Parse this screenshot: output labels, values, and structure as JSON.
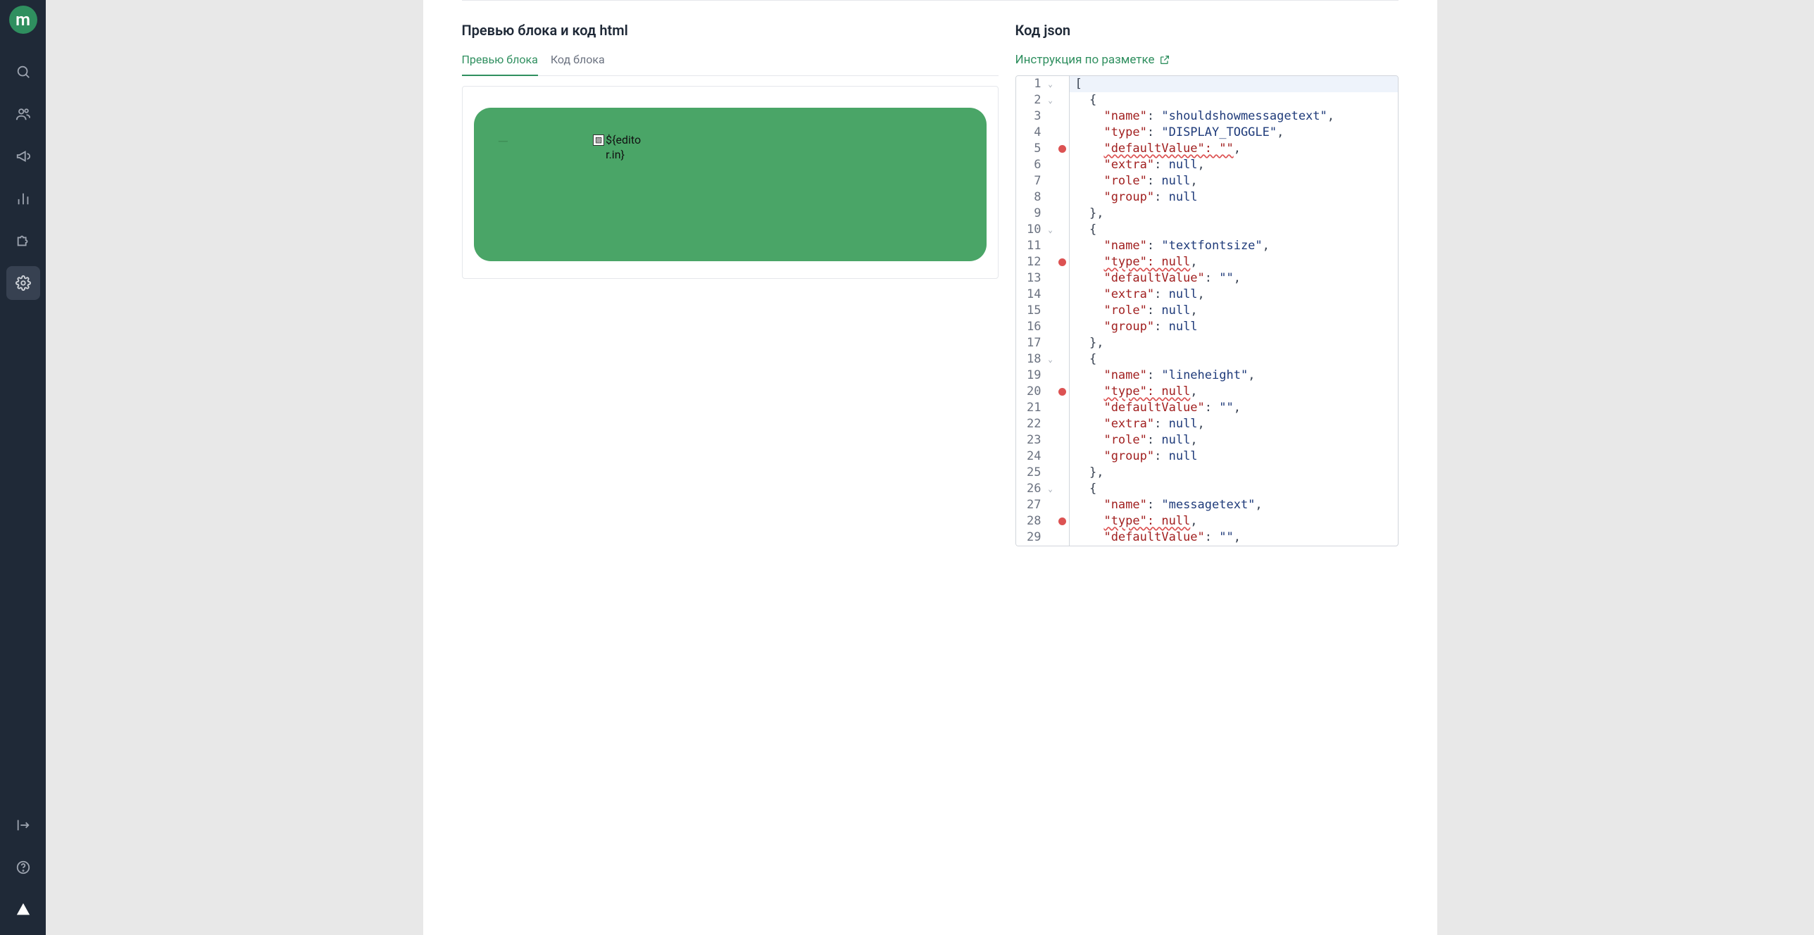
{
  "logo_letter": "m",
  "left_title": "Превью блока и код html",
  "right_title": "Код json",
  "instruction_link": "Инструкция по разметке",
  "tabs": {
    "preview": "Превью блока",
    "code": "Код блока"
  },
  "preview": {
    "placeholder_text": "${editor.in}",
    "placeholder_icon_label": "▨"
  },
  "json_editor": {
    "lines": [
      {
        "n": 1,
        "fold": true,
        "err": false,
        "tokens": [
          [
            "punc",
            "["
          ]
        ],
        "highlight": true
      },
      {
        "n": 2,
        "fold": true,
        "err": false,
        "tokens": [
          [
            "indent",
            1
          ],
          [
            "punc",
            "{"
          ]
        ]
      },
      {
        "n": 3,
        "fold": false,
        "err": false,
        "tokens": [
          [
            "indent",
            2
          ],
          [
            "key",
            "\"name\""
          ],
          [
            "punc",
            ": "
          ],
          [
            "str",
            "\"shouldshowmessagetext\""
          ],
          [
            "punc",
            ","
          ]
        ]
      },
      {
        "n": 4,
        "fold": false,
        "err": false,
        "tokens": [
          [
            "indent",
            2
          ],
          [
            "key",
            "\"type\""
          ],
          [
            "punc",
            ": "
          ],
          [
            "str",
            "\"DISPLAY_TOGGLE\""
          ],
          [
            "punc",
            ","
          ]
        ]
      },
      {
        "n": 5,
        "fold": false,
        "err": true,
        "tokens": [
          [
            "indent",
            2
          ],
          [
            "keyerr",
            "\"defaultValue\": \"\""
          ],
          [
            "punc",
            ","
          ]
        ]
      },
      {
        "n": 6,
        "fold": false,
        "err": false,
        "tokens": [
          [
            "indent",
            2
          ],
          [
            "key",
            "\"extra\""
          ],
          [
            "punc",
            ": "
          ],
          [
            "null",
            "null"
          ],
          [
            "punc",
            ","
          ]
        ]
      },
      {
        "n": 7,
        "fold": false,
        "err": false,
        "tokens": [
          [
            "indent",
            2
          ],
          [
            "key",
            "\"role\""
          ],
          [
            "punc",
            ": "
          ],
          [
            "null",
            "null"
          ],
          [
            "punc",
            ","
          ]
        ]
      },
      {
        "n": 8,
        "fold": false,
        "err": false,
        "tokens": [
          [
            "indent",
            2
          ],
          [
            "key",
            "\"group\""
          ],
          [
            "punc",
            ": "
          ],
          [
            "null",
            "null"
          ]
        ]
      },
      {
        "n": 9,
        "fold": false,
        "err": false,
        "tokens": [
          [
            "indent",
            1
          ],
          [
            "punc",
            "},"
          ]
        ]
      },
      {
        "n": 10,
        "fold": true,
        "err": false,
        "tokens": [
          [
            "indent",
            1
          ],
          [
            "punc",
            "{"
          ]
        ]
      },
      {
        "n": 11,
        "fold": false,
        "err": false,
        "tokens": [
          [
            "indent",
            2
          ],
          [
            "key",
            "\"name\""
          ],
          [
            "punc",
            ": "
          ],
          [
            "str",
            "\"textfontsize\""
          ],
          [
            "punc",
            ","
          ]
        ]
      },
      {
        "n": 12,
        "fold": false,
        "err": true,
        "tokens": [
          [
            "indent",
            2
          ],
          [
            "keyerr",
            "\"type\": null"
          ],
          [
            "punc",
            ","
          ]
        ]
      },
      {
        "n": 13,
        "fold": false,
        "err": false,
        "tokens": [
          [
            "indent",
            2
          ],
          [
            "key",
            "\"defaultValue\""
          ],
          [
            "punc",
            ": "
          ],
          [
            "str",
            "\"\""
          ],
          [
            "punc",
            ","
          ]
        ]
      },
      {
        "n": 14,
        "fold": false,
        "err": false,
        "tokens": [
          [
            "indent",
            2
          ],
          [
            "key",
            "\"extra\""
          ],
          [
            "punc",
            ": "
          ],
          [
            "null",
            "null"
          ],
          [
            "punc",
            ","
          ]
        ]
      },
      {
        "n": 15,
        "fold": false,
        "err": false,
        "tokens": [
          [
            "indent",
            2
          ],
          [
            "key",
            "\"role\""
          ],
          [
            "punc",
            ": "
          ],
          [
            "null",
            "null"
          ],
          [
            "punc",
            ","
          ]
        ]
      },
      {
        "n": 16,
        "fold": false,
        "err": false,
        "tokens": [
          [
            "indent",
            2
          ],
          [
            "key",
            "\"group\""
          ],
          [
            "punc",
            ": "
          ],
          [
            "null",
            "null"
          ]
        ]
      },
      {
        "n": 17,
        "fold": false,
        "err": false,
        "tokens": [
          [
            "indent",
            1
          ],
          [
            "punc",
            "},"
          ]
        ]
      },
      {
        "n": 18,
        "fold": true,
        "err": false,
        "tokens": [
          [
            "indent",
            1
          ],
          [
            "punc",
            "{"
          ]
        ]
      },
      {
        "n": 19,
        "fold": false,
        "err": false,
        "tokens": [
          [
            "indent",
            2
          ],
          [
            "key",
            "\"name\""
          ],
          [
            "punc",
            ": "
          ],
          [
            "str",
            "\"lineheight\""
          ],
          [
            "punc",
            ","
          ]
        ]
      },
      {
        "n": 20,
        "fold": false,
        "err": true,
        "tokens": [
          [
            "indent",
            2
          ],
          [
            "keyerr",
            "\"type\": null"
          ],
          [
            "punc",
            ","
          ]
        ]
      },
      {
        "n": 21,
        "fold": false,
        "err": false,
        "tokens": [
          [
            "indent",
            2
          ],
          [
            "key",
            "\"defaultValue\""
          ],
          [
            "punc",
            ": "
          ],
          [
            "str",
            "\"\""
          ],
          [
            "punc",
            ","
          ]
        ]
      },
      {
        "n": 22,
        "fold": false,
        "err": false,
        "tokens": [
          [
            "indent",
            2
          ],
          [
            "key",
            "\"extra\""
          ],
          [
            "punc",
            ": "
          ],
          [
            "null",
            "null"
          ],
          [
            "punc",
            ","
          ]
        ]
      },
      {
        "n": 23,
        "fold": false,
        "err": false,
        "tokens": [
          [
            "indent",
            2
          ],
          [
            "key",
            "\"role\""
          ],
          [
            "punc",
            ": "
          ],
          [
            "null",
            "null"
          ],
          [
            "punc",
            ","
          ]
        ]
      },
      {
        "n": 24,
        "fold": false,
        "err": false,
        "tokens": [
          [
            "indent",
            2
          ],
          [
            "key",
            "\"group\""
          ],
          [
            "punc",
            ": "
          ],
          [
            "null",
            "null"
          ]
        ]
      },
      {
        "n": 25,
        "fold": false,
        "err": false,
        "tokens": [
          [
            "indent",
            1
          ],
          [
            "punc",
            "},"
          ]
        ]
      },
      {
        "n": 26,
        "fold": true,
        "err": false,
        "tokens": [
          [
            "indent",
            1
          ],
          [
            "punc",
            "{"
          ]
        ]
      },
      {
        "n": 27,
        "fold": false,
        "err": false,
        "tokens": [
          [
            "indent",
            2
          ],
          [
            "key",
            "\"name\""
          ],
          [
            "punc",
            ": "
          ],
          [
            "str",
            "\"messagetext\""
          ],
          [
            "punc",
            ","
          ]
        ]
      },
      {
        "n": 28,
        "fold": false,
        "err": true,
        "tokens": [
          [
            "indent",
            2
          ],
          [
            "keyerr",
            "\"type\": null"
          ],
          [
            "punc",
            ","
          ]
        ]
      },
      {
        "n": 29,
        "fold": false,
        "err": false,
        "tokens": [
          [
            "indent",
            2
          ],
          [
            "key",
            "\"defaultValue\""
          ],
          [
            "punc",
            ": "
          ],
          [
            "str",
            "\"\""
          ],
          [
            "punc",
            ","
          ]
        ]
      }
    ]
  }
}
